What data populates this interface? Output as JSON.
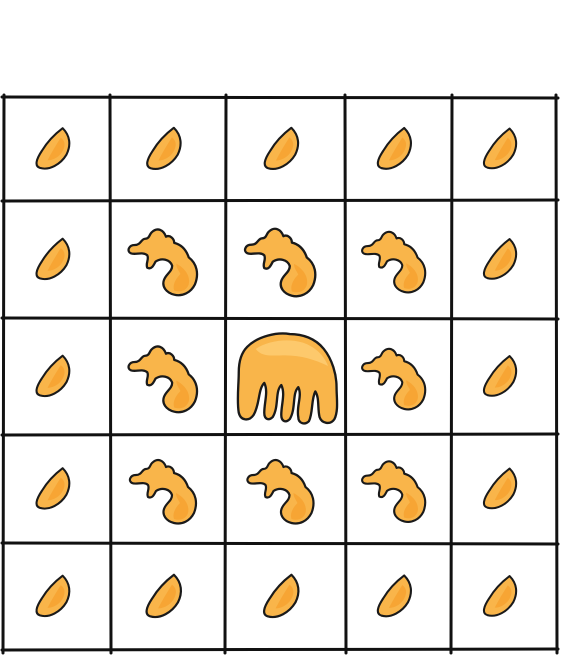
{
  "board": {
    "rows": 5,
    "cols": 5,
    "flame_color": "#f9b54a",
    "outline_color": "#1a1a1a",
    "grid_color": "#111111",
    "cells": [
      [
        "small-flame",
        "small-flame",
        "small-flame",
        "small-flame",
        "small-flame"
      ],
      [
        "small-flame",
        "medium-flame",
        "medium-flame",
        "medium-flame",
        "small-flame"
      ],
      [
        "small-flame",
        "medium-flame",
        "large-flame",
        "medium-flame",
        "small-flame"
      ],
      [
        "small-flame",
        "medium-flame",
        "medium-flame",
        "medium-flame",
        "small-flame"
      ],
      [
        "small-flame",
        "small-flame",
        "small-flame",
        "small-flame",
        "small-flame"
      ]
    ]
  }
}
